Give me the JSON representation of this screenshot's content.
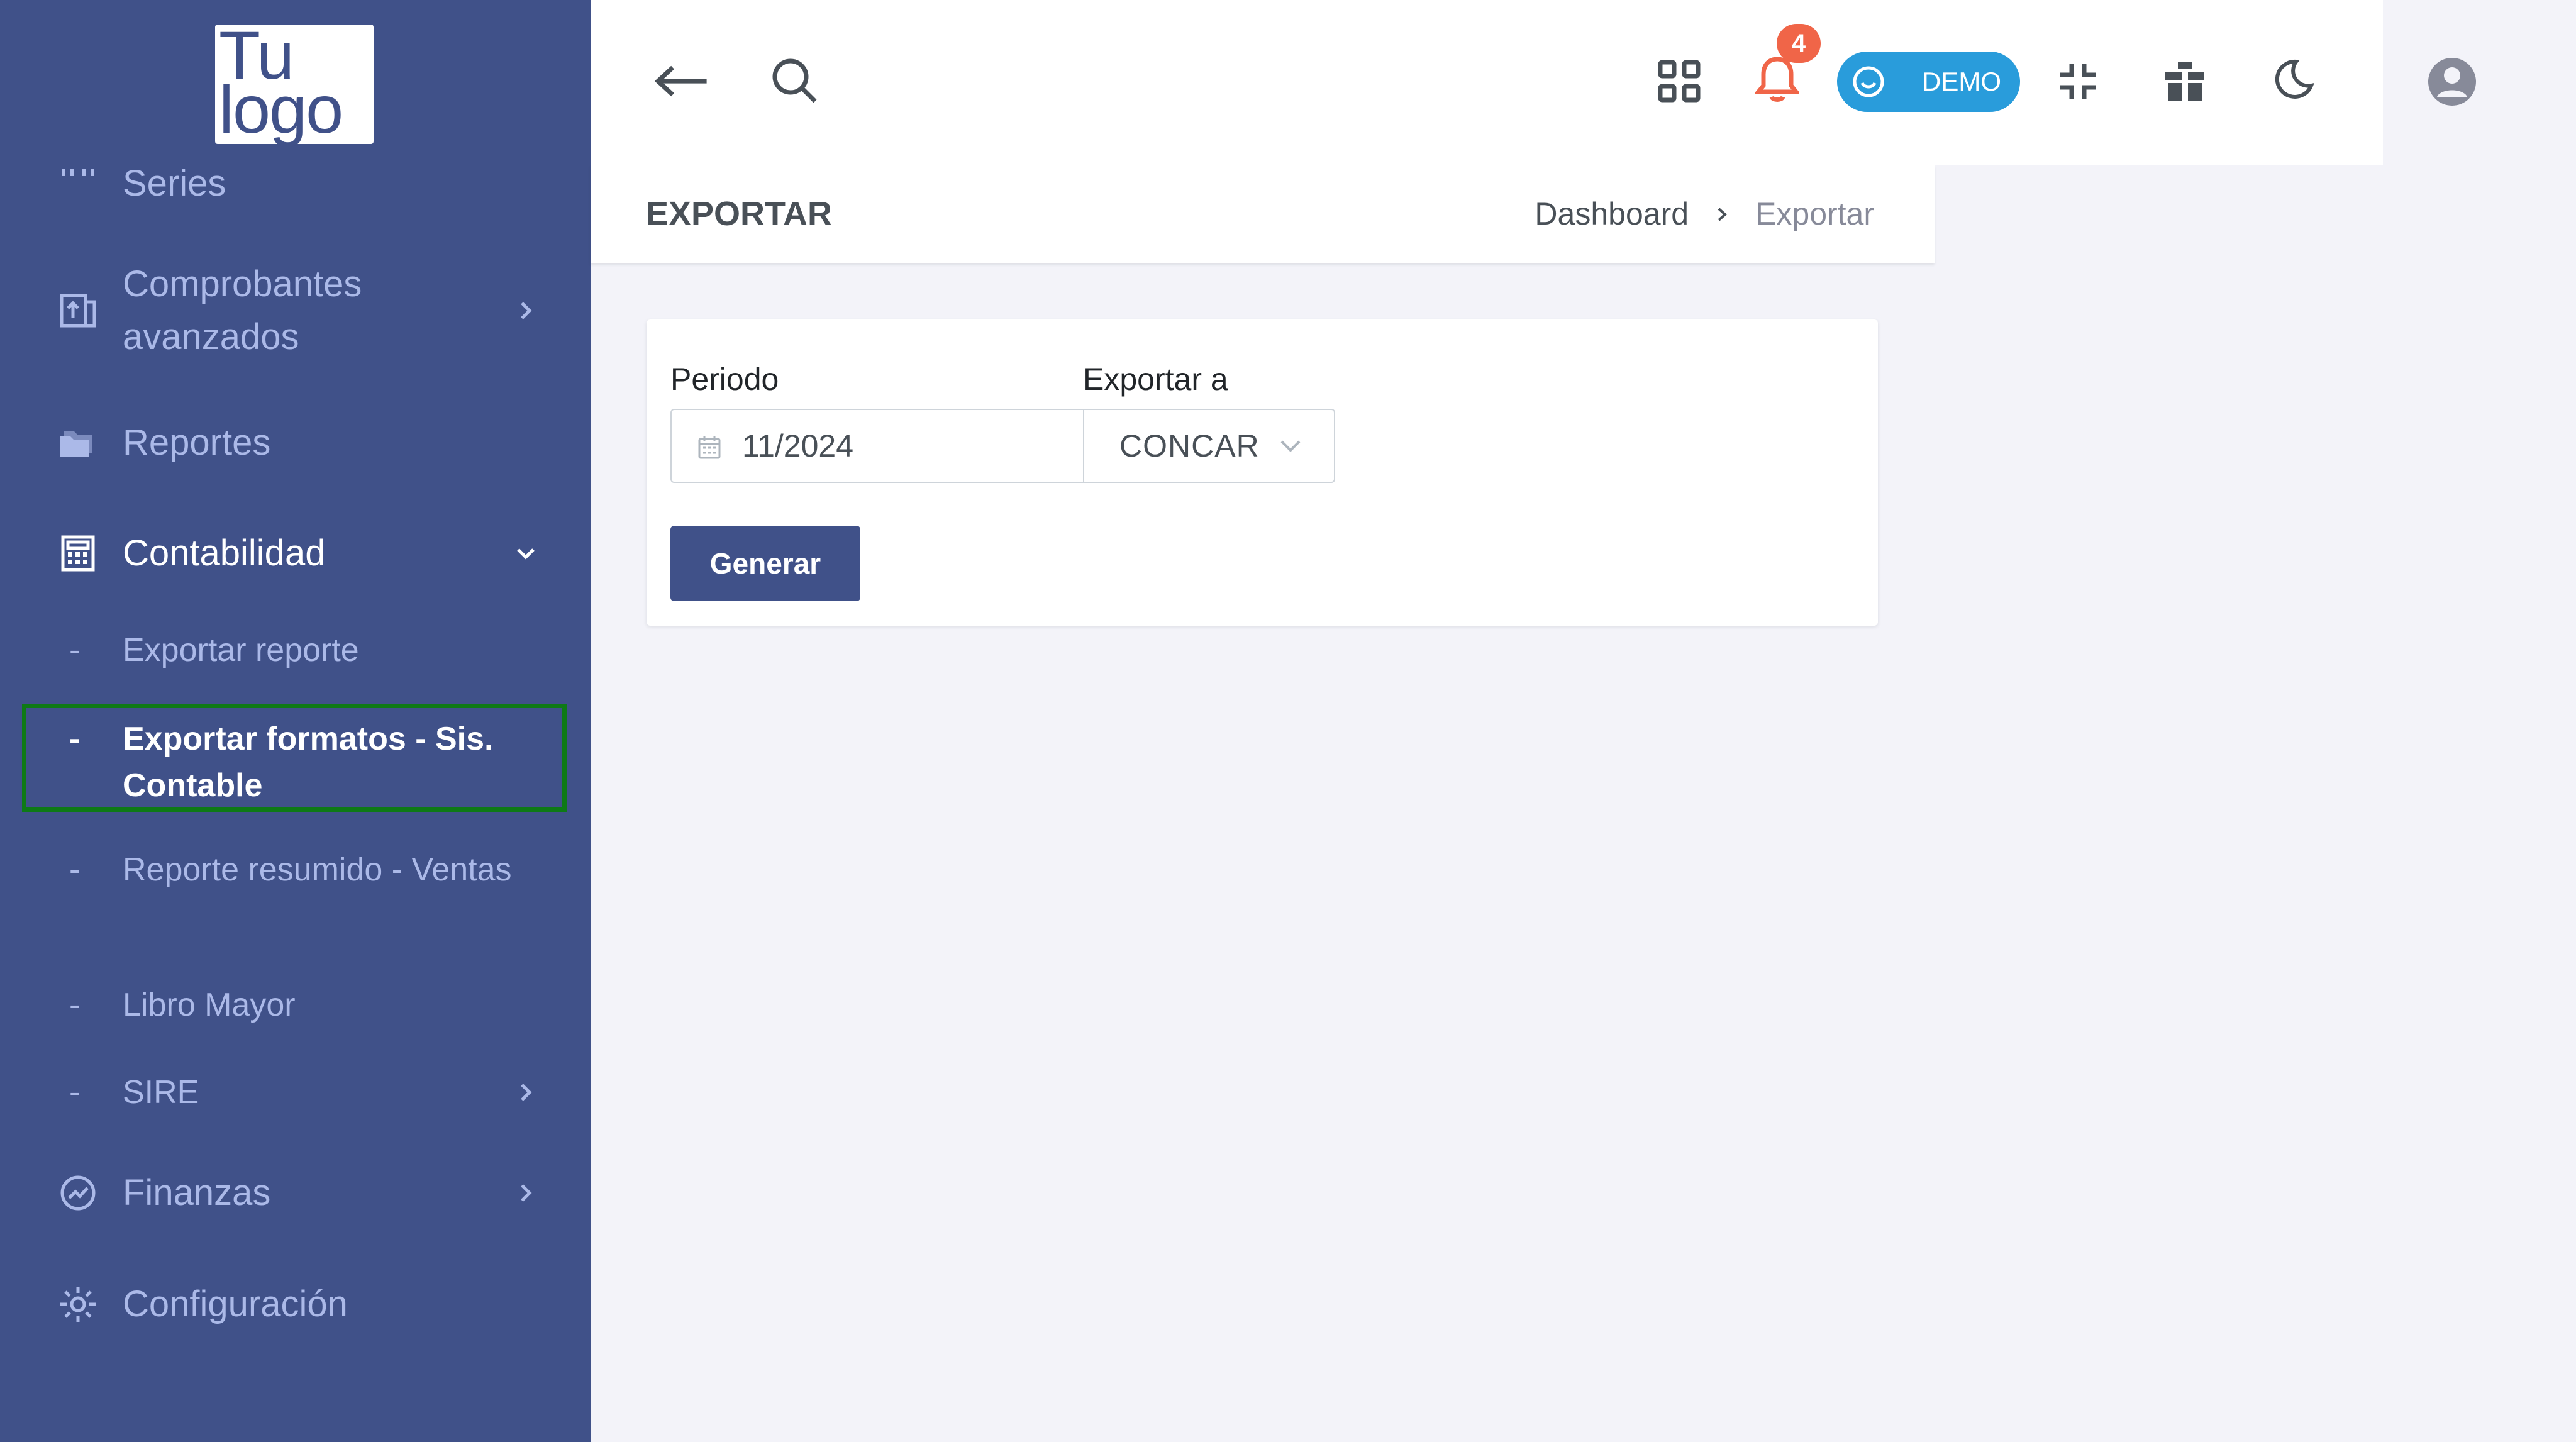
{
  "logo": {
    "line1": "Tu",
    "line2": "logo"
  },
  "sidebar": {
    "items": [
      {
        "label": "Series",
        "icon": "quote-dots-icon"
      },
      {
        "label": "Comprobantes\navanzados",
        "icon": "document-arrow-icon",
        "expandable": true
      },
      {
        "label": "Reportes",
        "icon": "folders-icon"
      },
      {
        "label": "Contabilidad",
        "icon": "calculator-icon",
        "expanded": true
      },
      {
        "label": "Finanzas",
        "icon": "chart-circle-icon",
        "expandable": true
      },
      {
        "label": "Configuración",
        "icon": "gear-icon"
      }
    ],
    "contabilidad_sub": [
      {
        "label": "Exportar reporte"
      },
      {
        "label": "Exportar formatos - Sis. Contable",
        "active": true
      },
      {
        "label": "Reporte resumido - Ventas"
      },
      {
        "label": "Libro Mayor"
      },
      {
        "label": "SIRE",
        "expandable": true
      }
    ],
    "dash": "-"
  },
  "topbar": {
    "notifications_count": "4",
    "demo_label": "DEMO"
  },
  "page": {
    "title": "EXPORTAR",
    "breadcrumb": [
      "Dashboard",
      "Exportar"
    ]
  },
  "form": {
    "period_label": "Periodo",
    "period_value": "11/2024",
    "export_label": "Exportar a",
    "export_value": "CONCAR",
    "generate_label": "Generar"
  },
  "colors": {
    "sidebar_bg": "#405189",
    "sidebar_text": "#abb9e8",
    "accent": "#405189",
    "badge": "#f06548",
    "demo_pill": "#299cdb",
    "highlight_border": "#0e7a16"
  }
}
